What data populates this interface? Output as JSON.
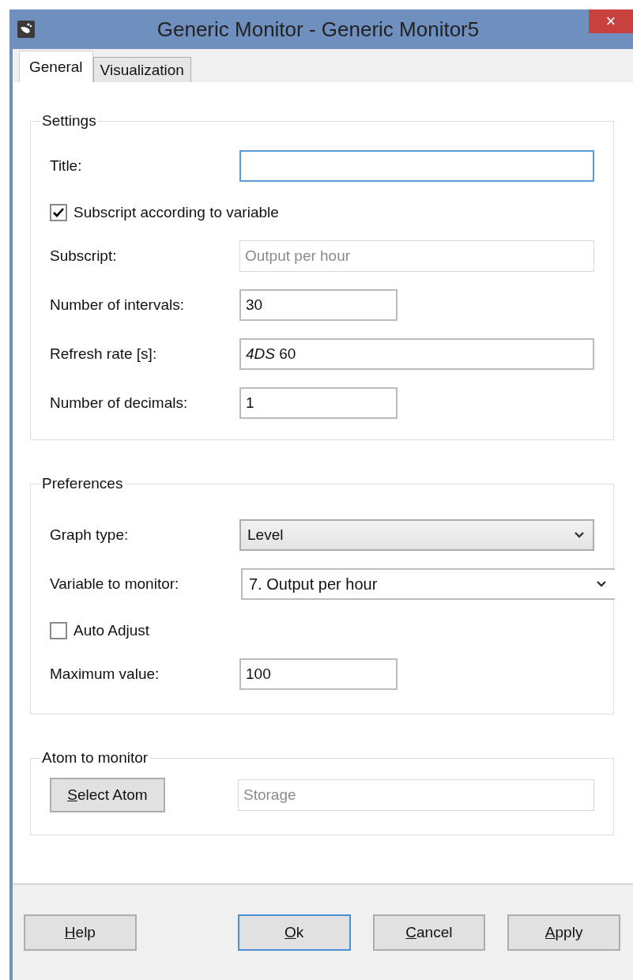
{
  "window": {
    "title": "Generic Monitor - Generic Monitor5",
    "close": "×"
  },
  "tabs": [
    {
      "label": "General",
      "selected": true
    },
    {
      "label": "Visualization",
      "selected": false
    }
  ],
  "settings": {
    "legend": "Settings",
    "title": {
      "label": "Title:",
      "focused": true
    },
    "subscript_checkbox": {
      "label": "Subscript according to variable",
      "checked": true
    },
    "subscript": {
      "label": "Subscript:",
      "value": "Output per hour",
      "disabled": true
    },
    "intervals": {
      "label": "Number of intervals:",
      "value": "30"
    },
    "refresh_rate": {
      "label": "Refresh rate [s]:",
      "value": "*4DS* 60"
    },
    "decimals": {
      "label": "Number of decimals:",
      "value": "1"
    }
  },
  "preferences": {
    "legend": "Preferences",
    "graph_type": {
      "label": "Graph type:",
      "value": "Level",
      "kind": "button"
    },
    "variable": {
      "label": "Variable to monitor:",
      "value": "7. Output per hour",
      "kind": "combo"
    },
    "auto_adjust": {
      "label": "Auto Adjust",
      "checked": false
    },
    "maximum": {
      "label": "Maximum value:",
      "value": "100"
    }
  },
  "atom": {
    "legend": "Atom to monitor",
    "button": {
      "label": "Select Atom",
      "mnemonic": true
    },
    "value": "Storage",
    "disabled": true
  },
  "buttons": [
    {
      "label": "Help",
      "mnemonic": true,
      "default": false
    },
    {
      "label": "Ok",
      "mnemonic": true,
      "default": true
    },
    {
      "label": "Cancel",
      "mnemonic": true,
      "default": false
    },
    {
      "label": "Apply",
      "mnemonic": true,
      "default": false
    }
  ]
}
